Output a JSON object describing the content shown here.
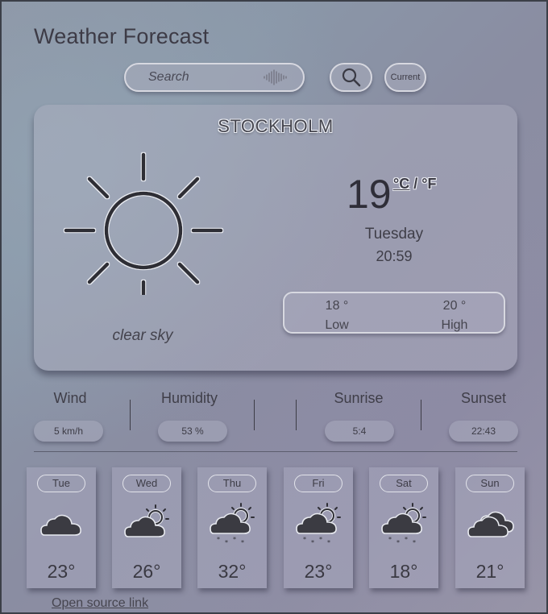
{
  "app": {
    "title": "Weather Forecast"
  },
  "search": {
    "placeholder": "Search",
    "value": ""
  },
  "buttons": {
    "current_label": "Current"
  },
  "current": {
    "city": "STOCKHOLM",
    "description": "clear sky",
    "temperature": "19",
    "unit_c": "°C",
    "unit_sep": "/",
    "unit_f": "°F",
    "day": "Tuesday",
    "time": "20:59",
    "low_value": "18 °",
    "low_label": "Low",
    "high_value": "20 °",
    "high_label": "High",
    "icon": "sun-icon"
  },
  "stats": [
    {
      "label": "Wind",
      "value": "5 km/h"
    },
    {
      "label": "Humidity",
      "value": "53 %"
    },
    {
      "label": "Sunrise",
      "value": "5:4"
    },
    {
      "label": "Sunset",
      "value": "22:43"
    }
  ],
  "forecast": [
    {
      "day": "Tue",
      "temp": "23°",
      "icon": "cloud-icon"
    },
    {
      "day": "Wed",
      "temp": "26°",
      "icon": "partly-cloudy-icon"
    },
    {
      "day": "Thu",
      "temp": "32°",
      "icon": "snow-sun-icon"
    },
    {
      "day": "Fri",
      "temp": "23°",
      "icon": "snow-sun-icon"
    },
    {
      "day": "Sat",
      "temp": "18°",
      "icon": "snow-sun-icon"
    },
    {
      "day": "Sun",
      "temp": "21°",
      "icon": "double-cloud-icon"
    }
  ],
  "footer": {
    "link_text": "Open source link"
  },
  "colors": {
    "icon_stroke": "#2f2f36",
    "icon_fill": "#3b3b42",
    "icon_glow": "#e8eaf0"
  }
}
